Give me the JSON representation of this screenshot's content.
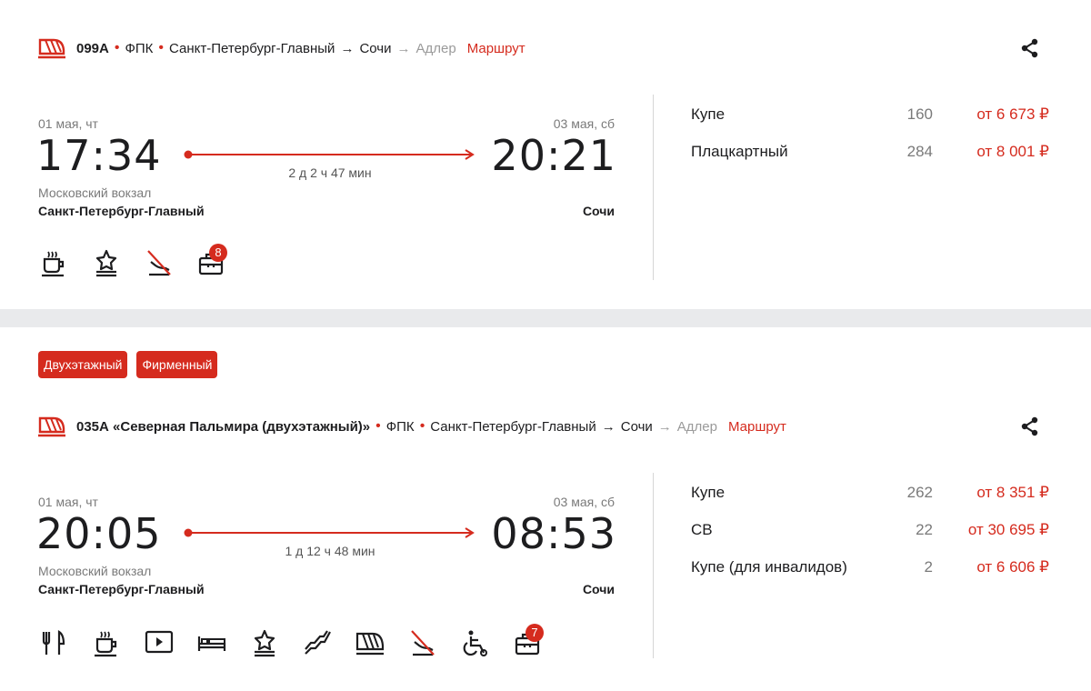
{
  "trains": [
    {
      "badges": [],
      "number": "099А",
      "carrier": "ФПК",
      "route_from": "Санкт-Петербург-Главный",
      "route_to": "Сочи",
      "route_via": "Адлер",
      "route_link": "Маршрут",
      "dep_date": "01 мая, чт",
      "arr_date": "03 мая, сб",
      "dep_time": "17:34",
      "arr_time": "20:21",
      "duration": "2 д 2 ч 47 мин",
      "dep_station": "Московский вокзал",
      "dep_city": "Санкт-Петербург-Главный",
      "arr_city": "Сочи",
      "amenities": [
        "coffee-icon",
        "star-icon",
        "no-pets-icon",
        "luggage-icon"
      ],
      "luggage_count": "8",
      "seats": [
        {
          "type": "Купе",
          "count": "160",
          "price": "от 6 673 ₽"
        },
        {
          "type": "Плацкартный",
          "count": "284",
          "price": "от 8 001 ₽"
        }
      ]
    },
    {
      "badges": [
        "Двухэтажный",
        "Фирменный"
      ],
      "number": "035А «Северная Пальмира (двухэтажный)»",
      "carrier": "ФПК",
      "route_from": "Санкт-Петербург-Главный",
      "route_to": "Сочи",
      "route_via": "Адлер",
      "route_link": "Маршрут",
      "dep_date": "01 мая, чт",
      "arr_date": "03 мая, сб",
      "dep_time": "20:05",
      "arr_time": "08:53",
      "duration": "1 д 12 ч 48 мин",
      "dep_station": "Московский вокзал",
      "dep_city": "Санкт-Петербург-Главный",
      "arr_city": "Сочи",
      "amenities": [
        "restaurant-icon",
        "coffee-icon",
        "video-icon",
        "bed-icon",
        "star-icon",
        "stairs-icon",
        "train-icon",
        "no-pets-icon",
        "wheelchair-icon",
        "luggage-icon"
      ],
      "luggage_count": "7",
      "seats": [
        {
          "type": "Купе",
          "count": "262",
          "price": "от 8 351 ₽"
        },
        {
          "type": "СВ",
          "count": "22",
          "price": "от 30 695 ₽"
        },
        {
          "type": "Купе (для инвалидов)",
          "count": "2",
          "price": "от 6 606 ₽"
        }
      ]
    }
  ],
  "colors": {
    "accent": "#d52b1e",
    "muted": "#7a7a7a",
    "background": "#e9eaec"
  }
}
